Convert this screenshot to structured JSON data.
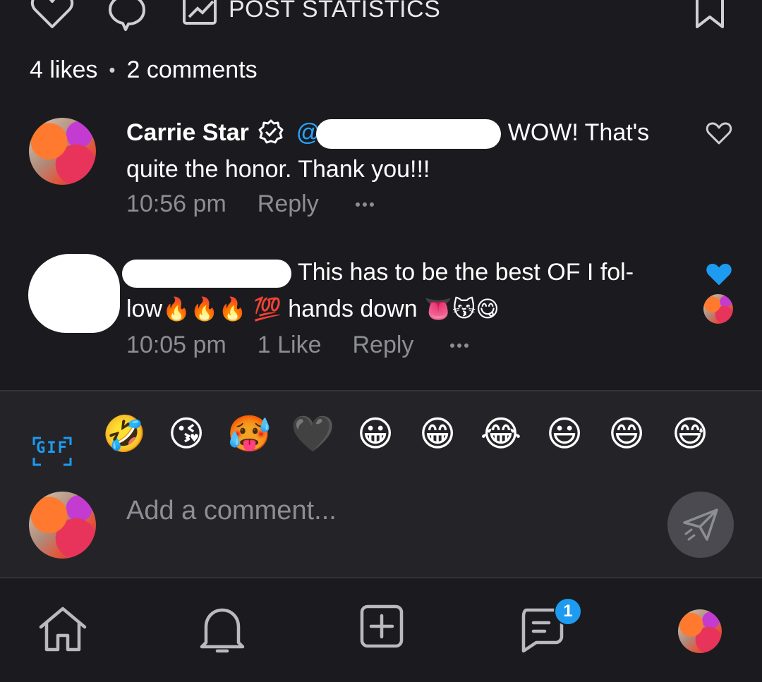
{
  "top_bar": {
    "post_statistics_label": "POST STATISTICS",
    "icons": [
      "heart-icon",
      "comment-icon",
      "statistics-icon",
      "bookmark-icon"
    ]
  },
  "counts": {
    "likes": "4 likes",
    "separator": "•",
    "comments": "2 comments"
  },
  "comments": [
    {
      "name": "Carrie Star",
      "verified": true,
      "mention_prefix": "@",
      "text": "WOW! That's quite the honor. Thank you!!!",
      "time": "10:56 pm",
      "likes_label": "",
      "reply_label": "Reply",
      "liked": false
    },
    {
      "name": "",
      "text_part1": "This has to be the best OF I fol-",
      "text_part2": "low",
      "emoji_fire": "🔥🔥🔥",
      "emoji_hundred": "💯",
      "text_part3": " hands down ",
      "emoji_end": "👅😽😋",
      "time": "10:05 pm",
      "likes_label": "1 Like",
      "reply_label": "Reply",
      "liked": true
    }
  ],
  "composer": {
    "gif_label": "GIF",
    "emojis": [
      "🤣",
      "😘",
      "🥵",
      "🖤",
      "😀",
      "😁",
      "😂",
      "😃",
      "😄",
      "😅"
    ],
    "placeholder": "Add a comment..."
  },
  "navbar": {
    "items": [
      "home-icon",
      "notifications-icon",
      "add-post-icon",
      "messages-icon",
      "profile-avatar"
    ],
    "messages_badge": "1"
  },
  "colors": {
    "background": "#1b1b1f",
    "composer_bg": "#242428",
    "accent": "#1d9bf0",
    "muted_text": "#8d8d95"
  }
}
